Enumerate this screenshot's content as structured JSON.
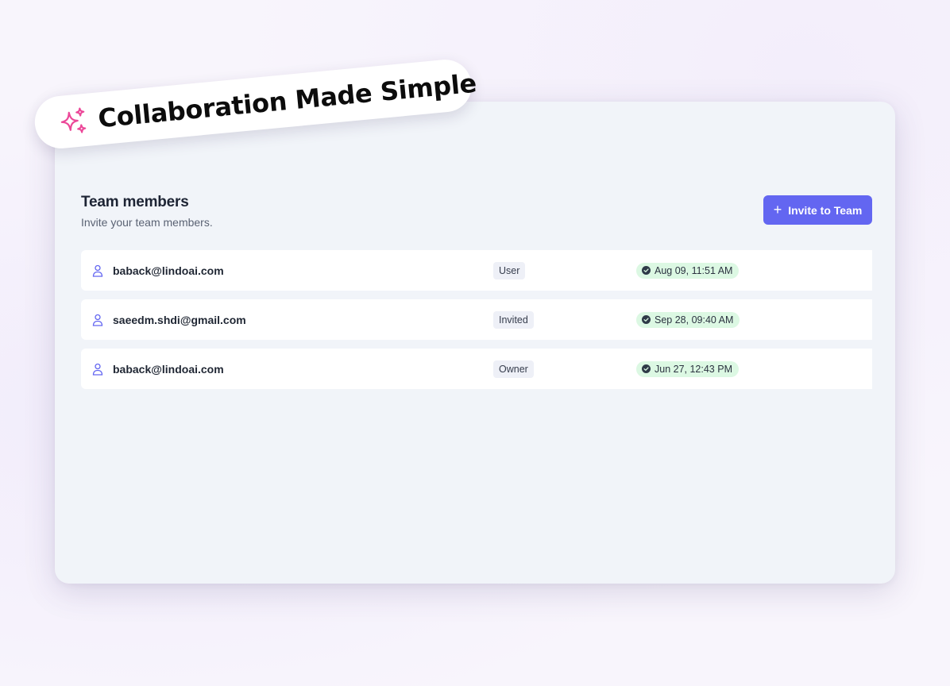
{
  "banner": {
    "text": "Collaboration Made Simple",
    "icon": "sparkle-icon",
    "accent": "#ec4899"
  },
  "header": {
    "title": "Team members",
    "subtitle": "Invite your team members."
  },
  "invite_button": {
    "icon": "plus-icon",
    "label": "Invite to Team",
    "color": "#6366f1"
  },
  "members": [
    {
      "email": "baback@lindoai.com",
      "role": "User",
      "date": "Aug 09, 11:51 AM"
    },
    {
      "email": "saeedm.shdi@gmail.com",
      "role": "Invited",
      "date": "Sep 28, 09:40 AM"
    },
    {
      "email": "baback@lindoai.com",
      "role": "Owner",
      "date": "Jun 27, 12:43 PM"
    }
  ]
}
